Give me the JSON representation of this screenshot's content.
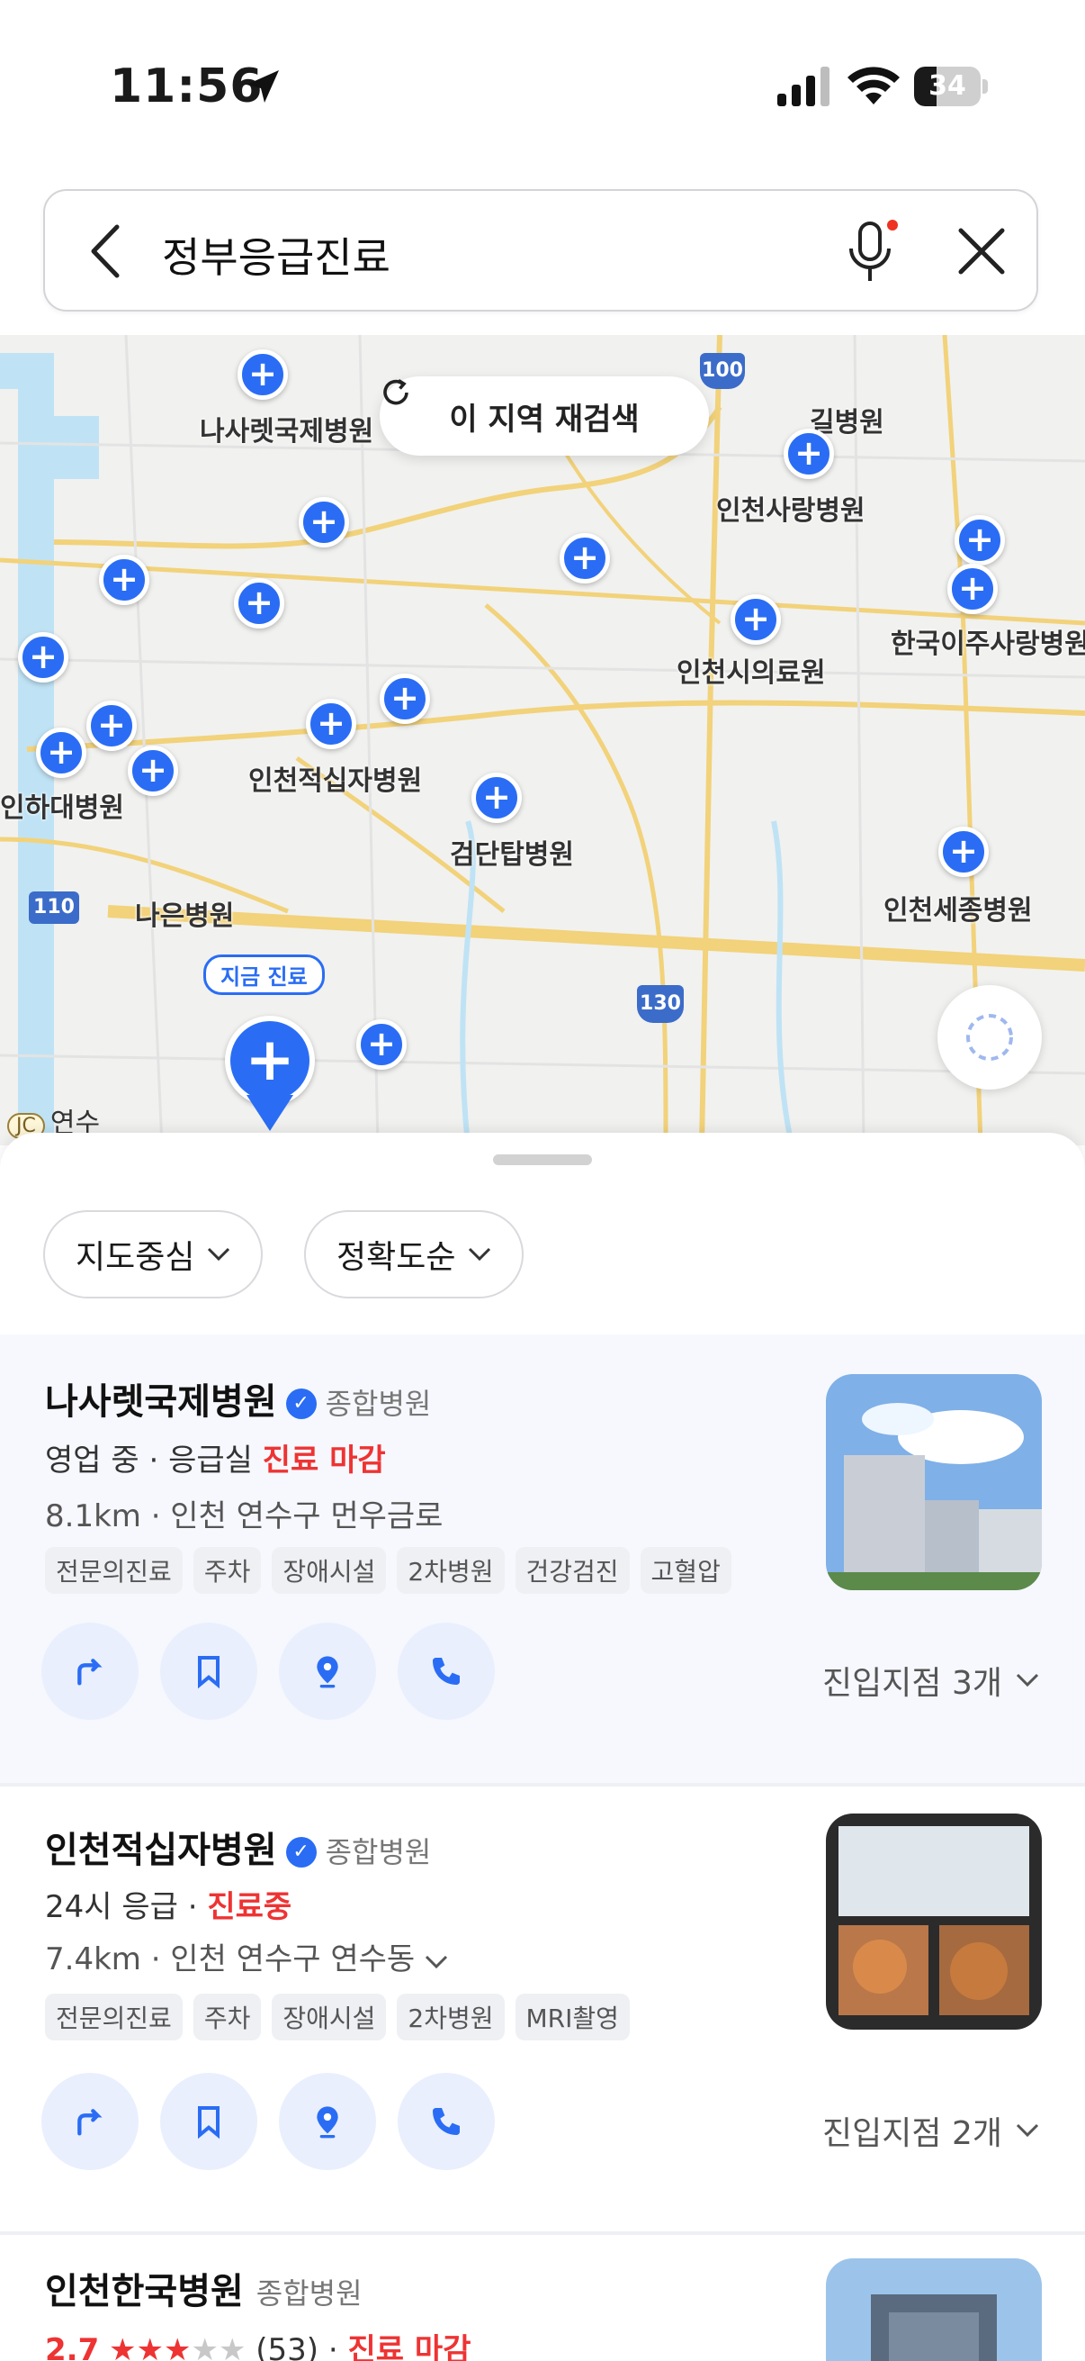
{
  "status_bar": {
    "time": "11:56",
    "battery": "34",
    "battery_level": 0.34
  },
  "search": {
    "query": "정부응급진료"
  },
  "map": {
    "search_area_button": "이 지역 재검색",
    "labels": [
      "나사렛국제병원",
      "길병원",
      "인천적십자병원",
      "인하대병원",
      "인천사랑병원",
      "인천시의료원",
      "한국이주사랑병원",
      "인천세종병원",
      "검단탑병원",
      "나은병원",
      "연수"
    ],
    "route_numbers": [
      "100",
      "110",
      "130"
    ],
    "tag_label": "지금 진료",
    "attribution_jc": "JC"
  },
  "sheet": {
    "filters": [
      "지도중심",
      "정확도순"
    ],
    "results": [
      {
        "title": "나사렛국제병원",
        "category": "종합병원",
        "status_line": "영업 중 · 응급실",
        "status_red": "진료 마감",
        "address": "8.1km · 인천 연수구 먼우금로",
        "tags": [
          "전문의진료",
          "주차",
          "장애시설",
          "2차병원",
          "건강검진",
          "고혈압"
        ],
        "entry": "진입지점 3개"
      },
      {
        "title": "인천적십자병원",
        "category": "종합병원",
        "status_line": "24시 응급 ·",
        "status_red": "진료중",
        "address": "7.4km · 인천 연수구 연수동",
        "tags": [
          "전문의진료",
          "주차",
          "장애시설",
          "2차병원",
          "MRI촬영"
        ],
        "entry": "진입지점 2개"
      },
      {
        "title": "인천한국병원",
        "category": "종합병원",
        "rating": "2.7",
        "reviews": "(53)",
        "status_red": "진료 마감"
      }
    ]
  }
}
